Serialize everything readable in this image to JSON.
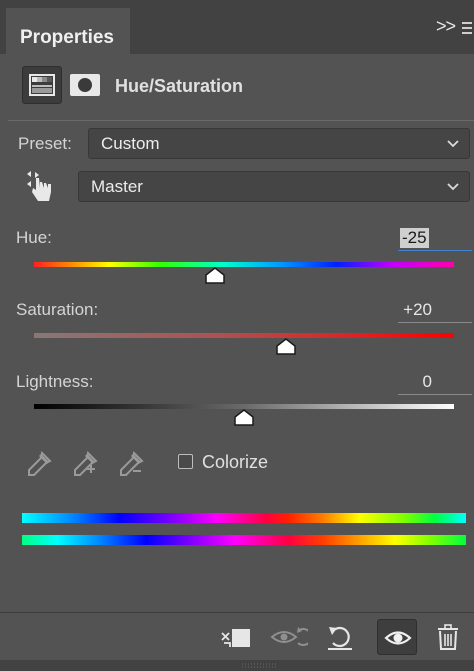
{
  "panel": {
    "tab_title": "Properties",
    "collapse_glyph": ">>",
    "adjustment_title": "Hue/Saturation"
  },
  "preset": {
    "label": "Preset:",
    "value": "Custom"
  },
  "channel": {
    "value": "Master"
  },
  "hue": {
    "label": "Hue:",
    "value": "-25",
    "level": -25,
    "range": [
      -180,
      180
    ]
  },
  "saturation": {
    "label": "Saturation:",
    "value": "+20",
    "level": 20,
    "range": [
      -100,
      100
    ]
  },
  "lightness": {
    "label": "Lightness:",
    "value": "0",
    "level": 0,
    "range": [
      -100,
      100
    ]
  },
  "tools": {
    "eyedroppers": [
      "eyedropper-icon",
      "eyedropper-plus-icon",
      "eyedropper-minus-icon"
    ],
    "colorize_label": "Colorize",
    "colorize_checked": false
  },
  "footer": {
    "buttons": [
      "clip-to-layer-icon",
      "view-previous-state-icon",
      "reset-icon",
      "toggle-visibility-icon",
      "delete-icon"
    ]
  },
  "colors": {
    "panel_bg": "#535353",
    "tab_bar_bg": "#424242",
    "accent": "#3f80cf"
  }
}
